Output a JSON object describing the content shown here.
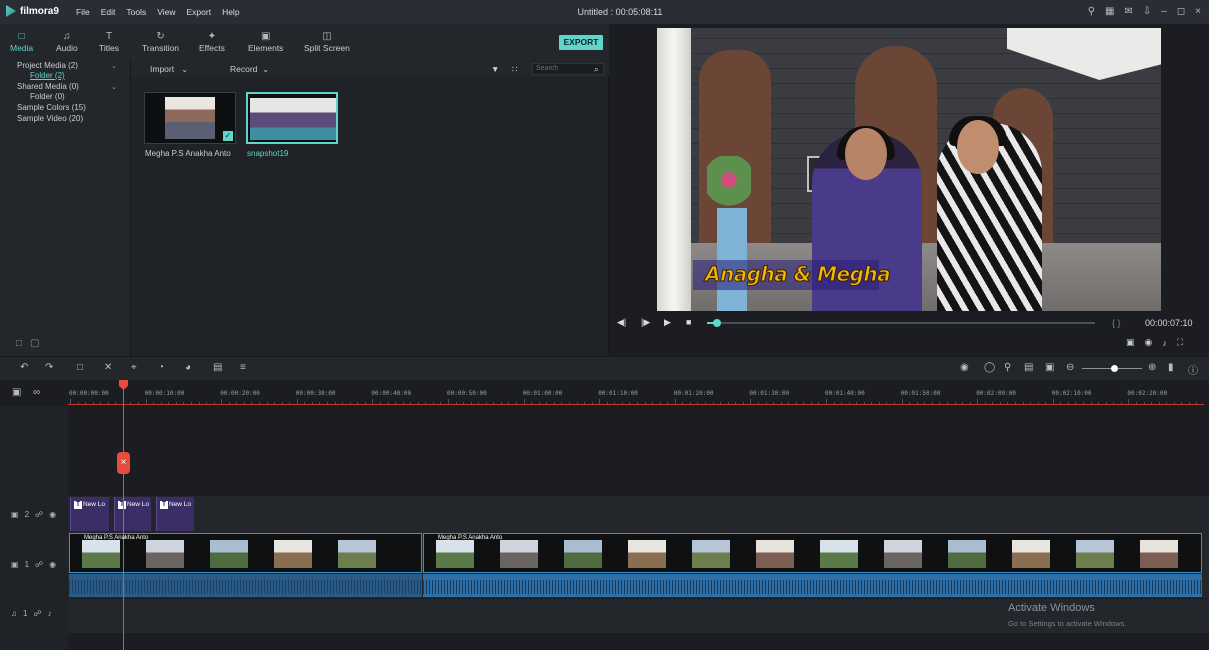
{
  "app": {
    "name": "filmora9",
    "document_title": "Untitled : 00:05:08:11"
  },
  "menu": [
    "File",
    "Edit",
    "Tools",
    "View",
    "Export",
    "Help"
  ],
  "tabs": [
    {
      "label": "Media",
      "icon": "folder-icon",
      "active": true
    },
    {
      "label": "Audio",
      "icon": "music-note-icon"
    },
    {
      "label": "Titles",
      "icon": "text-icon"
    },
    {
      "label": "Transition",
      "icon": "transition-icon"
    },
    {
      "label": "Effects",
      "icon": "effects-icon"
    },
    {
      "label": "Elements",
      "icon": "elements-icon"
    },
    {
      "label": "Split Screen",
      "icon": "split-screen-icon"
    }
  ],
  "export_label": "EXPORT",
  "media_tree": {
    "project_media": "Project Media (2)",
    "folder": "Folder (2)",
    "shared_media": "Shared Media (0)",
    "shared_folder": "Folder (0)",
    "sample_colors": "Sample Colors (15)",
    "sample_video": "Sample Video (20)"
  },
  "library": {
    "import_label": "Import",
    "record_label": "Record",
    "search_placeholder": "Search",
    "items": [
      {
        "label": "Megha P.S Anakha Anto"
      },
      {
        "label": "snapshot19"
      }
    ]
  },
  "preview": {
    "caption": "Anagha & Megha",
    "timecode": "00:00:07:10",
    "braces": "{  }",
    "progress": 0.02
  },
  "ruler_labels": [
    "00:00:00:00",
    "00:00:10:00",
    "00:00:20:00",
    "00:00:30:00",
    "00:00:40:00",
    "00:00:50:00",
    "00:01:00:00",
    "00:01:10:00",
    "00:01:20:00",
    "00:01:30:00",
    "00:01:40:00",
    "00:01:50:00",
    "00:02:00:00",
    "00:02:10:00",
    "00:02:20:00"
  ],
  "tracks": {
    "title_track_num": "2",
    "video_track_num": "1",
    "audio_track_num": "1",
    "title_clips": [
      "New Lo",
      "New Lo",
      "New Lo"
    ],
    "video_clip_labels": [
      "Megha P.S Anakha Anto",
      "Megha P.S Anakha Anto"
    ]
  },
  "watermark": {
    "title": "Activate Windows",
    "subtitle": "Go to Settings to activate Windows."
  },
  "colors": {
    "accent": "#5fd6c7",
    "playhead": "#e74c3c",
    "title_clip": "#3b2d66",
    "audio_clip": "#2f6fa8"
  }
}
